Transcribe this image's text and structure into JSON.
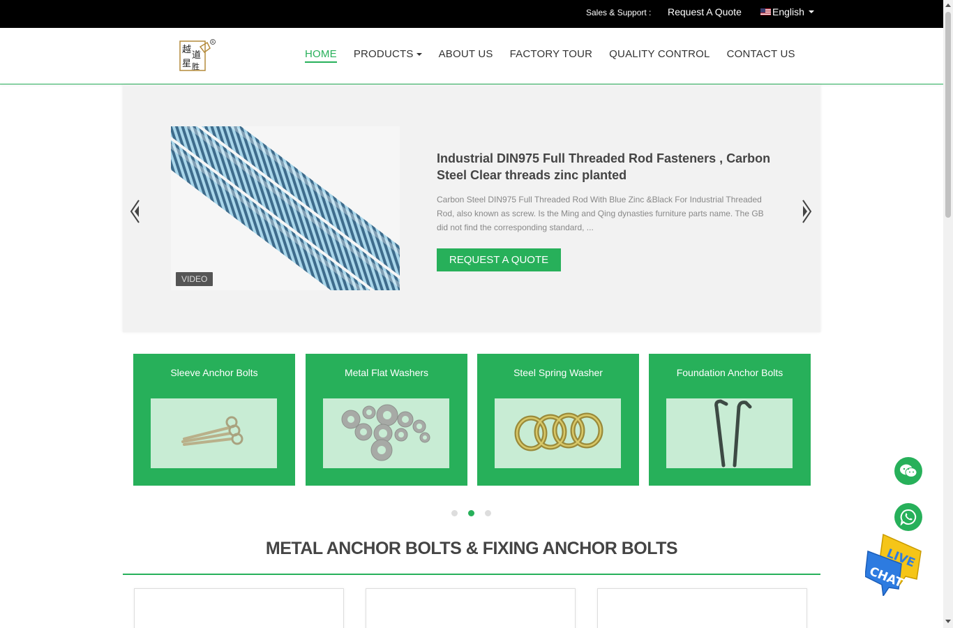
{
  "topbar": {
    "sales_label": "Sales & Support :",
    "request_quote": "Request A Quote",
    "language": "English"
  },
  "nav": {
    "items": [
      {
        "label": "HOME",
        "active": true
      },
      {
        "label": "PRODUCTS",
        "dropdown": true
      },
      {
        "label": "ABOUT US"
      },
      {
        "label": "FACTORY TOUR"
      },
      {
        "label": "QUALITY CONTROL"
      },
      {
        "label": "CONTACT US"
      }
    ]
  },
  "hero": {
    "badge": "VIDEO",
    "title": "Industrial DIN975 Full Threaded Rod Fasteners , Carbon Steel Clear threads zinc planted",
    "description": "Carbon Steel DIN975 Full Threaded Rod With Blue Zinc &Black For Industrial Threaded Rod, also known as screw. Is the Ming and Qing dynasties furniture parts name. The GB did not find the corresponding standard, ...",
    "button": "REQUEST A QUOTE"
  },
  "categories": [
    {
      "label": "Sleeve Anchor Bolts"
    },
    {
      "label": "Metal Flat Washers"
    },
    {
      "label": "Steel Spring Washer"
    },
    {
      "label": "Foundation Anchor Bolts"
    }
  ],
  "carousel": {
    "active_dot": 2,
    "dot_count": 3
  },
  "section": {
    "title": "METAL ANCHOR BOLTS & FIXING ANCHOR BOLTS"
  },
  "colors": {
    "accent": "#27b05a",
    "topbar_bg": "#000000"
  },
  "floaters": {
    "live_chat_line1": "LIVE",
    "live_chat_line2": "CHAT"
  }
}
